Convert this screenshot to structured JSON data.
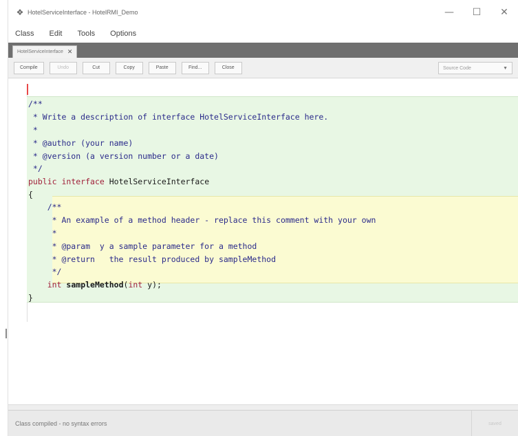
{
  "window": {
    "title": "HotelServiceInterface - HotelRMI_Demo",
    "controls": {
      "minimize": "—",
      "maximize": "☐",
      "close": "✕"
    }
  },
  "menu": [
    "Class",
    "Edit",
    "Tools",
    "Options"
  ],
  "tabs": [
    {
      "label": "HotelServiceInterface",
      "close": "✕"
    }
  ],
  "toolbar": {
    "buttons": [
      {
        "label": "Compile",
        "enabled": true
      },
      {
        "label": "Undo",
        "enabled": false
      },
      {
        "label": "Cut",
        "enabled": true
      },
      {
        "label": "Copy",
        "enabled": true
      },
      {
        "label": "Paste",
        "enabled": true
      },
      {
        "label": "Find...",
        "enabled": true
      },
      {
        "label": "Close",
        "enabled": true
      }
    ],
    "view_select": "Source Code"
  },
  "code": {
    "lines": [
      "/**",
      " * Write a description of interface HotelServiceInterface here.",
      " *",
      " * @author (your name)",
      " * @version (a version number or a date)",
      " */",
      "public interface HotelServiceInterface",
      "{",
      "    /**",
      "     * An example of a method header - replace this comment with your own",
      "     *",
      "     * @param  y a sample parameter for a method",
      "     * @return   the result produced by sampleMethod",
      "     */",
      "    int sampleMethod(int y);",
      "}"
    ]
  },
  "status": {
    "message": "Class compiled - no syntax errors",
    "right_label": "saved"
  },
  "colors": {
    "class_scope": "#e8f7e4",
    "method_scope": "#fbfbd2",
    "keyword": "#a0203a",
    "comment": "#2a2a8a",
    "tab_strip": "#6f6f6f"
  }
}
